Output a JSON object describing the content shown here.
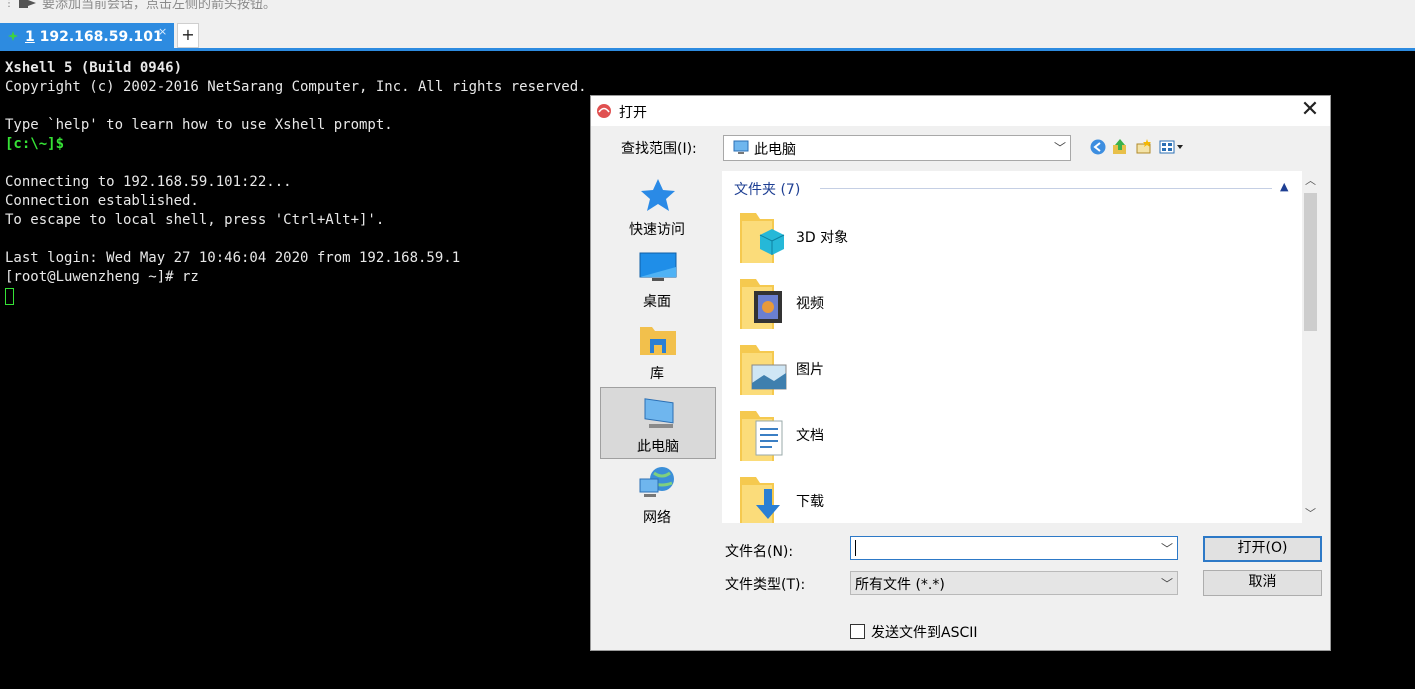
{
  "hint_bar": {
    "text": "要添加当前会话，点击左侧的箭头按钮。",
    "icon": "arrow-session-icon"
  },
  "tabs": [
    {
      "index": "1",
      "label": "192.168.59.101",
      "status_color": "#3fd23f"
    }
  ],
  "new_tab_label": "+",
  "terminal": {
    "lines": [
      {
        "text": "Xshell 5 (Build 0946)",
        "style": "bold"
      },
      {
        "text": "Copyright (c) 2002-2016 NetSarang Computer, Inc. All rights reserved.",
        "style": "normal"
      },
      {
        "text": "",
        "style": "normal"
      },
      {
        "text": "Type `help' to learn how to use Xshell prompt.",
        "style": "normal"
      },
      {
        "text": "[c:\\~]$",
        "style": "green"
      },
      {
        "text": "",
        "style": "normal"
      },
      {
        "text": "Connecting to 192.168.59.101:22...",
        "style": "normal"
      },
      {
        "text": "Connection established.",
        "style": "normal"
      },
      {
        "text": "To escape to local shell, press 'Ctrl+Alt+]'.",
        "style": "normal"
      },
      {
        "text": "",
        "style": "normal"
      },
      {
        "text": "Last login: Wed May 27 10:46:04 2020 from 192.168.59.1",
        "style": "normal"
      },
      {
        "text": "[root@Luwenzheng ~]# rz",
        "style": "normal"
      }
    ]
  },
  "dialog": {
    "title": "打开",
    "close_label": "✕",
    "look_in_label": "查找范围(I):",
    "look_in_value": "此电脑",
    "places": [
      {
        "label": "快速访问",
        "icon": "star-icon",
        "selected": false
      },
      {
        "label": "桌面",
        "icon": "desktop-icon",
        "selected": false
      },
      {
        "label": "库",
        "icon": "library-icon",
        "selected": false
      },
      {
        "label": "此电脑",
        "icon": "computer-icon",
        "selected": true
      },
      {
        "label": "网络",
        "icon": "network-icon",
        "selected": false
      }
    ],
    "group_header": "文件夹 (7)",
    "folders": [
      {
        "name": "3D 对象",
        "icon": "3d-objects-folder-icon"
      },
      {
        "name": "视频",
        "icon": "videos-folder-icon"
      },
      {
        "name": "图片",
        "icon": "pictures-folder-icon"
      },
      {
        "name": "文档",
        "icon": "documents-folder-icon"
      },
      {
        "name": "下载",
        "icon": "downloads-folder-icon"
      }
    ],
    "file_name_label": "文件名(N):",
    "file_name_value": "",
    "file_type_label": "文件类型(T):",
    "file_type_value": "所有文件 (*.*)",
    "open_button": "打开(O)",
    "cancel_button": "取消",
    "ascii_checkbox_label": "发送文件到ASCII",
    "ascii_checked": false
  },
  "colors": {
    "accent": "#2d8be0",
    "terminal_bg": "#000000",
    "prompt_green": "#36e236"
  }
}
